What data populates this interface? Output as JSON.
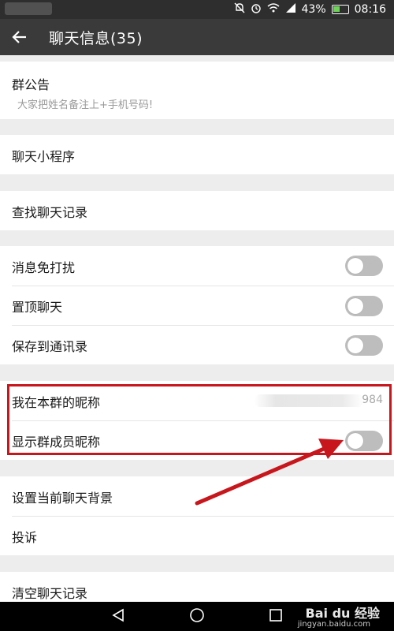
{
  "status_bar": {
    "battery_percent": "43%",
    "time": "08:16"
  },
  "header": {
    "title": "聊天信息(35)"
  },
  "announcement": {
    "label": "群公告",
    "text": "大家把姓名备注上+手机号码!"
  },
  "mini_program": {
    "label": "聊天小程序"
  },
  "search_history": {
    "label": "查找聊天记录"
  },
  "toggles": [
    {
      "label": "消息免打扰",
      "on": false
    },
    {
      "label": "置顶聊天",
      "on": false
    },
    {
      "label": "保存到通讯录",
      "on": false
    }
  ],
  "nickname": {
    "label": "我在本群的昵称",
    "value_suffix": "984"
  },
  "show_nicknames": {
    "label": "显示群成员昵称",
    "on": false
  },
  "background": {
    "label": "设置当前聊天背景"
  },
  "report": {
    "label": "投诉"
  },
  "clear_history": {
    "label": "清空聊天记录"
  },
  "watermark": {
    "logo": "Bai du 经验",
    "url": "jingyan.baidu.com"
  },
  "colors": {
    "highlight": "#c8161d",
    "toolbar": "#3a3a3a",
    "toggle_off": "#bdbdbd"
  }
}
